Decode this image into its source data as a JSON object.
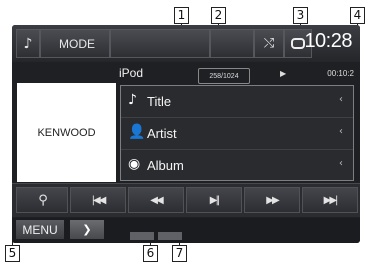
{
  "callouts": [
    "1",
    "2",
    "3",
    "4",
    "5",
    "6",
    "7"
  ],
  "header": {
    "mode_label": "MODE",
    "clock": "10:28"
  },
  "source": {
    "name": "iPod",
    "counter": "258/1024",
    "elapsed": "00:10:2"
  },
  "artwork": {
    "label": "KENWOOD"
  },
  "track_info": {
    "title": "Title",
    "artist": "Artist",
    "album": "Album"
  },
  "controls": {
    "search": "⚲",
    "prev": "|◀◀",
    "rewind": "◀◀",
    "play_pause": "▶||",
    "forward": "▶▶",
    "next": "▶▶|"
  },
  "footer": {
    "menu_label": "MENU",
    "arrow": "❯"
  },
  "icons": {
    "mode": "music-note-icon",
    "shuffle": "shuffle-icon",
    "repeat": "repeat-icon",
    "title": "music-note-icon",
    "artist": "person-icon",
    "album": "disc-icon"
  }
}
